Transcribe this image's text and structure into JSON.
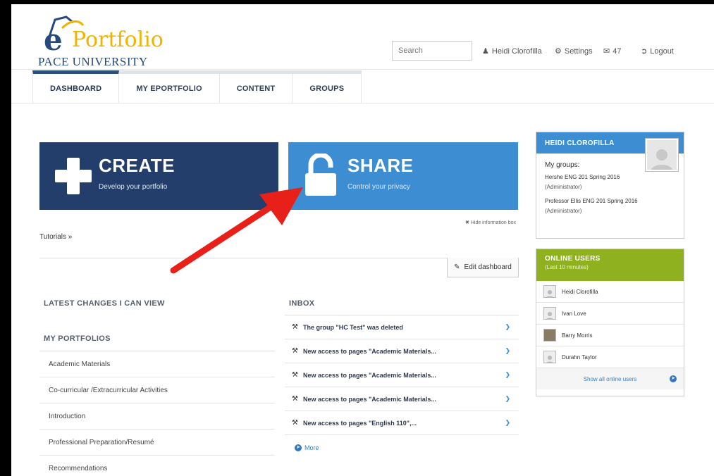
{
  "header": {
    "logo": {
      "brand_e": "e",
      "brand_rest": "Portfolio",
      "university": "PACE UNIVERSITY"
    },
    "search": {
      "placeholder": "Search"
    },
    "user_link": "Heidi Clorofilla",
    "settings": "Settings",
    "inbox_count": "47",
    "logout": "Logout"
  },
  "tabs": [
    {
      "label": "DASHBOARD"
    },
    {
      "label": "MY EPORTFOLIO"
    },
    {
      "label": "CONTENT"
    },
    {
      "label": "GROUPS"
    }
  ],
  "hero": {
    "create": {
      "title": "CREATE",
      "subtitle": "Develop your portfolio"
    },
    "share": {
      "title": "SHARE",
      "subtitle": "Control your privacy"
    },
    "hide_info": "Hide information box",
    "tutorials": "Tutorials »"
  },
  "edit_dashboard": "Edit dashboard",
  "latest_changes": {
    "title": "LATEST CHANGES I CAN VIEW"
  },
  "my_portfolios": {
    "title": "MY PORTFOLIOS",
    "items": [
      "Academic Materials",
      "Co-curricular /Extracurricular Activities",
      "Introduction",
      "Professional Preparation/Resumé",
      "Recommendations"
    ]
  },
  "inbox": {
    "title": "INBOX",
    "items": [
      "The group \"HC Test\" was deleted",
      "New access to pages \"Academic Materials...",
      "New access to pages \"Academic Materials...",
      "New access to pages \"Academic Materials...",
      "New access to pages \"English 110\",..."
    ],
    "more": "More"
  },
  "profile": {
    "name": "HEIDI CLOROFILLA",
    "my_groups_label": "My groups:",
    "groups": [
      {
        "name": "Hershe ENG 201 Spring 2016",
        "role": "(Administrator)"
      },
      {
        "name": "Professor Ellis ENG 201 Spring 2016",
        "role": "(Administrator)"
      }
    ]
  },
  "online_users": {
    "title": "ONLINE USERS",
    "subtitle": "(Last 10 minutes)",
    "users": [
      "Heidi Clorofilla",
      "Ivan Love",
      "Barry Morris",
      "Durahn Taylor"
    ],
    "show_all": "Show all online users"
  },
  "colors": {
    "create_tile": "#233e6a",
    "share_tile": "#3c8dd1",
    "online_header": "#8fb11f",
    "annotation_arrow": "#e8201a"
  }
}
